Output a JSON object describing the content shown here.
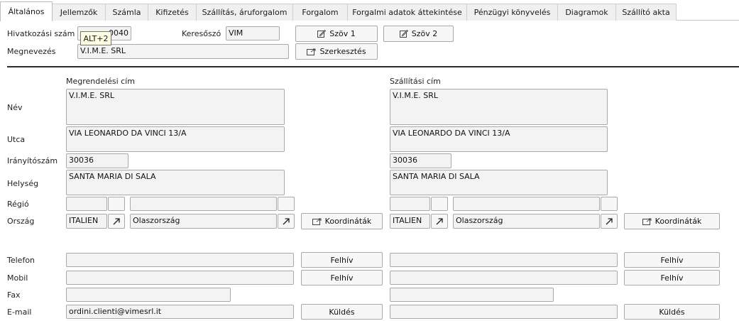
{
  "tabs": [
    {
      "label": "Általános",
      "active": true
    },
    {
      "label": "Jellemzők"
    },
    {
      "label": "Számla"
    },
    {
      "label": "Kifizetés"
    },
    {
      "label": "Szállítás, áruforgalom"
    },
    {
      "label": "Forgalom"
    },
    {
      "label": "Forgalmi adatok áttekintése"
    },
    {
      "label": "Pénzügyi könyvelés"
    },
    {
      "label": "Diagramok"
    },
    {
      "label": "Szállító akta"
    }
  ],
  "header": {
    "ref_label": "Hivatkozási szám",
    "ref_value": "0040",
    "tooltip": "ALT+2",
    "search_label": "Keresőszó",
    "search_value": "VIM",
    "text1_button": "Szöv 1",
    "text2_button": "Szöv 2",
    "name_label": "Megnevezés",
    "name_value": "V.I.M.E. SRL",
    "edit_button": "Szerkesztés"
  },
  "labels": {
    "name": "Név",
    "street": "Utca",
    "zip": "Irányítószám",
    "city": "Helység",
    "region": "Régió",
    "country": "Ország",
    "phone": "Telefon",
    "mobile": "Mobil",
    "fax": "Fax",
    "email": "E-mail"
  },
  "order_address": {
    "heading": "Megrendelési cím",
    "name": "V.I.M.E. SRL",
    "street": "VIA LEONARDO DA VINCI 13/A",
    "zip": "30036",
    "city": "SANTA MARIA DI SALA",
    "region_code": "",
    "region_name": "",
    "country_code": "ITALIEN",
    "country_name": "Olaszország",
    "coords_button": "Koordináták",
    "phone": "",
    "mobile": "",
    "fax": "",
    "email": "ordini.clienti@vimesrl.it",
    "call_button": "Felhív",
    "send_button": "Küldés"
  },
  "delivery_address": {
    "heading": "Szállítási cím",
    "name": "V.I.M.E. SRL",
    "street": "VIA LEONARDO DA VINCI 13/A",
    "zip": "30036",
    "city": "SANTA MARIA DI SALA",
    "region_code": "",
    "region_name": "",
    "country_code": "ITALIEN",
    "country_name": "Olaszország",
    "coords_button": "Koordináták",
    "phone": "",
    "mobile": "",
    "fax": "",
    "email": "",
    "call_button": "Felhív",
    "send_button": "Küldés"
  }
}
